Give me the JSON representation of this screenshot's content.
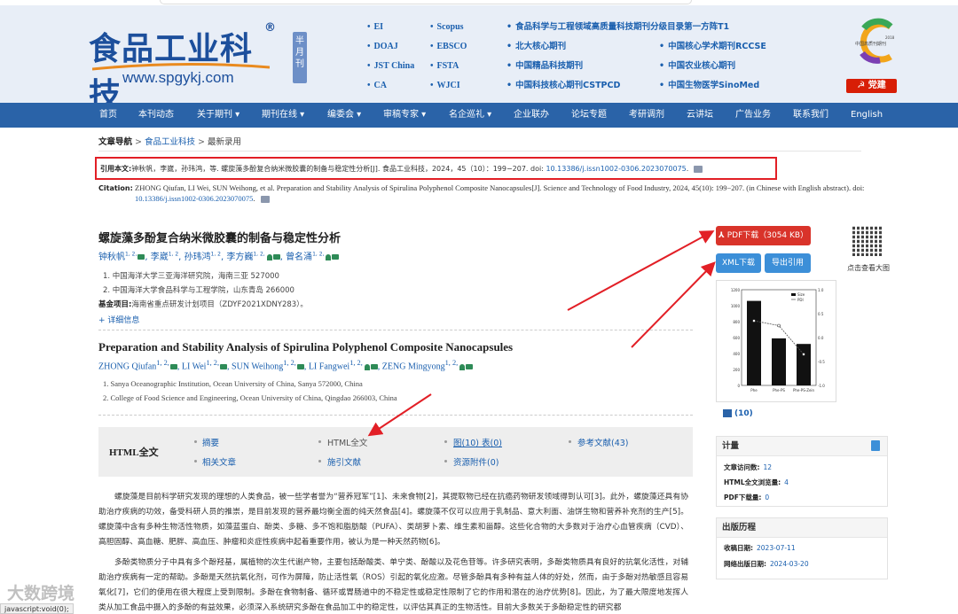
{
  "header": {
    "logo_cn": "食品工业科技",
    "logo_reg": "®",
    "logo_url": "www.spgykj.com",
    "semi_monthly": "半月刊",
    "col1": [
      "EI",
      "DOAJ",
      "JST China",
      "CA"
    ],
    "col2": [
      "Scopus",
      "EBSCO",
      "FSTA",
      "WJCI"
    ],
    "col3": [
      "食品科学与工程领域高质量科技期刊分级目录第一方阵T1",
      "北大核心期刊",
      "中国精品科技期刊",
      "中国科技核心期刊CSTPCD"
    ],
    "col4": [
      "中国核心学术期刊RCCSE",
      "中国农业核心期刊",
      "中国生物医学SinoMed"
    ],
    "cert_text": "中国高质刊期刊 2018",
    "party_button": "党建"
  },
  "nav": [
    "首页",
    "本刊动态",
    "关于期刊 ▾",
    "期刊在线 ▾",
    "编委会 ▾",
    "审稿专家 ▾",
    "名企巡礼 ▾",
    "企业联办",
    "论坛专题",
    "考研调剂",
    "云讲坛",
    "广告业务",
    "联系我们",
    "English"
  ],
  "breadcrumb": {
    "label": "文章导航",
    "journal": "食品工业科技",
    "current": "最新录用",
    "sep": ">"
  },
  "cite_cn": {
    "label": "引用本文:",
    "text": "钟秋帆，李崴，孙玮鸿，等. 螺旋藻多酚复合纳米微胶囊的制备与稳定性分析[J]. 食品工业科技，2024，45（10）：199−207. doi: ",
    "doi": "10.13386/j.issn1002-0306.2023070075",
    "end": "."
  },
  "cite_en": {
    "label": "Citation:",
    "text": "ZHONG Qiufan, LI Wei, SUN Weihong, et al. Preparation and Stability Analysis of Spirulina Polyphenol Composite Nanocapsules[J]. Science and Technology of Food Industry, 2024, 45(10): 199−207. (in Chinese with English abstract). doi: ",
    "doi": "10.13386/j.issn1002-0306.2023070075",
    "end": "."
  },
  "article": {
    "title_cn": "螺旋藻多酚复合纳米微胶囊的制备与稳定性分析",
    "authors_cn": [
      {
        "name": "钟秋帆",
        "sup": "1, 2,"
      },
      {
        "name": "李崴",
        "sup": "1, 2"
      },
      {
        "name": "孙玮鸿",
        "sup": "1, 2"
      },
      {
        "name": "李方巍",
        "sup": "1, 2,"
      },
      {
        "name": "曾名涌",
        "sup": "1, 2,"
      }
    ],
    "affil_cn": [
      "1.  中国海洋大学三亚海洋研究院，海南三亚 527000",
      "2.  中国海洋大学食品科学与工程学院，山东青岛 266000"
    ],
    "fund_label": "基金项目:",
    "fund_text": "海南省重点研发计划项目（ZDYF2021XDNY283）。",
    "detail_link": "+ 详细信息",
    "title_en": "Preparation and Stability Analysis of Spirulina Polyphenol Composite Nanocapsules",
    "authors_en": [
      {
        "name": "ZHONG Qiufan",
        "sup": "1, 2,"
      },
      {
        "name": "LI Wei",
        "sup": "1, 2,"
      },
      {
        "name": "SUN Weihong",
        "sup": "1, 2,"
      },
      {
        "name": "LI Fangwei",
        "sup": "1, 2,"
      },
      {
        "name": "ZENG Mingyong",
        "sup": "1, 2,"
      }
    ],
    "affil_en": [
      "1.  Sanya Oceanographic Institution, Ocean University of China, Sanya 572000, China",
      "2.  College of Food Science and Engineering, Ocean University of China, Qingdao 266003, China"
    ]
  },
  "tabs": {
    "label": "HTML全文",
    "items": [
      "摘要",
      "HTML全文",
      "图(10) 表(0)",
      "参考文献(43)",
      "相关文章",
      "施引文献",
      "资源附件(0)"
    ]
  },
  "body": {
    "p1": "螺旋藻是目前科学研究发现的理想的人类食品，被一些学者誉为“营养冠军”[1]、未来食物[2]，其提取物已经在抗癌药物研发领域得到认可[3]。此外，螺旋藻还具有协助治疗疾病的功效，备受科研人员的推崇，是目前发现的营养最均衡全面的纯天然食品[4]。螺旋藻不仅可以应用于乳制品、意大利面、油饼生物和营养补充剂的生产[5]。螺旋藻中含有多种生物活性物质，如藻蓝蛋白、酚类、多糖、多不饱和脂肪酸（PUFA）、类胡萝卜素、维生素和甾醇。这些化合物的大多数对于治疗心血管疾病（CVD）、高胆固醇、高血糖、肥胖、高血压、肿瘤和炎症性疾病中起着重要作用，被认为是一种天然药物[6]。",
    "p2": "多酚类物质分子中具有多个酚羟基，属植物的次生代谢产物，主要包括酚酸类、单宁类、酚酸以及花色苷等。许多研究表明，多酚类物质具有良好的抗氧化活性，对辅助治疗疾病有一定的帮助。多酚是天然抗氧化剂，可作为屏障，防止活性氧（ROS）引起的氧化应激。尽管多酚具有多种有益人体的好处，然而，由于多酚对热敏感且容易氧化[7]，它们的使用在很大程度上受到限制。多酚在食物制备、循环或胃肠道中的不稳定性或稳定性限制了它的作用和潜在的治疗优势[8]。因此，为了最大限度地发挥人类从加工食品中摄入的多酚的有益效果，必须深入系统研究多酚在食品加工中的稳定性，以评估其真正的生物活性。目前大多数关于多酚稳定性的研究都"
  },
  "sidebar": {
    "pdf_button": "PDF下载（3054 KB）",
    "xml_button": "XML下载",
    "export_button": "导出引用",
    "qr_caption": "点击查看大图",
    "figures_link": "(10)",
    "stats": {
      "title": "计量",
      "rows": [
        {
          "label": "文章访问数:",
          "value": "12"
        },
        {
          "label": "HTML全文浏览量:",
          "value": "4"
        },
        {
          "label": "PDF下载量:",
          "value": "0"
        }
      ]
    },
    "history": {
      "title": "出版历程",
      "rows": [
        {
          "label": "收稿日期:",
          "value": "2023-07-11"
        },
        {
          "label": "网络出版日期:",
          "value": "2024-03-20"
        }
      ]
    }
  },
  "thumb_chart": {
    "categories": [
      "Phe",
      "Phe-PS",
      "Phe-PS-Zein"
    ],
    "left_ticks": [
      "1200",
      "1000",
      "800",
      "600",
      "400",
      "200",
      "0"
    ],
    "right_ticks": [
      "1.0",
      "0.5",
      "0.0",
      "-0.5",
      "-1.0"
    ],
    "legend": [
      "Size",
      "PDI"
    ],
    "size_values": [
      1060,
      590,
      520
    ],
    "pdi_values": [
      0.35,
      0.25,
      -0.35
    ]
  },
  "status_bar": "javascript:void(0);",
  "watermark": "大数跨境",
  "colors": {
    "nav": "#2a63a8",
    "header_bg": "#e8eef7",
    "highlight_box": "#e21f26",
    "link": "#1a5fae",
    "pdf_button": "#d9332a",
    "secondary_button": "#3c8fd8"
  }
}
